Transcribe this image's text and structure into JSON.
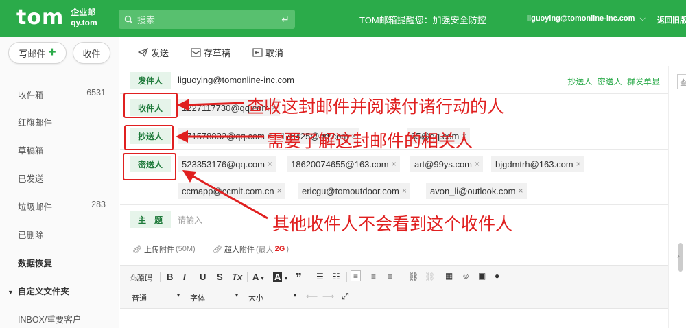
{
  "header": {
    "logo": "tom",
    "logo_sub1": "企业邮",
    "logo_sub2": "qy.tom",
    "search_placeholder": "搜索",
    "notice": "TOM邮箱提醒您：加强安全防控",
    "user": "liguoying@tomonline-inc.com",
    "user_caret": "⌵",
    "old_version": "返回旧版"
  },
  "sidebar": {
    "compose_label": "写邮件",
    "receive_label": "收件",
    "folders": [
      {
        "label": "收件箱",
        "count": "6531"
      },
      {
        "label": "红旗邮件",
        "count": ""
      },
      {
        "label": "草稿箱",
        "count": ""
      },
      {
        "label": "已发送",
        "count": ""
      },
      {
        "label": "垃圾邮件",
        "count": "283"
      },
      {
        "label": "已删除",
        "count": ""
      },
      {
        "label": "数据恢复",
        "count": ""
      }
    ],
    "custom_header": "自定义文件夹",
    "custom_items": [
      "INBOX/重要客户"
    ]
  },
  "toolbar": {
    "send": "发送",
    "save_draft": "存草稿",
    "cancel": "取消"
  },
  "form": {
    "from_label": "发件人",
    "from_value": "liguoying@tomonline-inc.com",
    "to_label": "收件人",
    "cc_label": "抄送人",
    "bcc_label": "密送人",
    "subject_label": "主　题",
    "subject_placeholder": "请输入",
    "link_cc": "抄送人",
    "link_bcc": "密送人",
    "link_group": "群发单显",
    "to_recipients": [
      "1227117730@qq.com"
    ],
    "cc_recipients": [
      "371578832@qq.com",
      "176425@qq.com",
      "65@qq.com"
    ],
    "bcc_recipients": [
      "523353176@qq.com",
      "18620074655@163.com",
      "art@99ys.com",
      "bjgdmtrh@163.com",
      "ccmapp@ccmit.com.cn",
      "ericgu@tomoutdoor.com",
      "avon_li@outlook.com"
    ],
    "remove_glyph": "×"
  },
  "attachments": {
    "upload": "上传附件",
    "upload_limit": "(50M)",
    "big": "超大附件",
    "big_limit_prefix": "(最大",
    "big_limit_value": "2G",
    "big_limit_suffix": ")"
  },
  "editor": {
    "source": "源码",
    "bold": "B",
    "italic": "I",
    "underline": "U",
    "strike": "S",
    "clear_format": "Tx",
    "font_color": "A",
    "bg_color": "A",
    "quote": "❞",
    "paragraph": "普通",
    "font": "字体",
    "size": "大小"
  },
  "annotations": [
    "查收这封邮件并阅读付诸行动的人",
    "需要了解这封邮件的相关人",
    "其他收件人不会看到这个收件人"
  ],
  "colors": {
    "brand": "#2bab4a",
    "annotation": "#e02020"
  }
}
